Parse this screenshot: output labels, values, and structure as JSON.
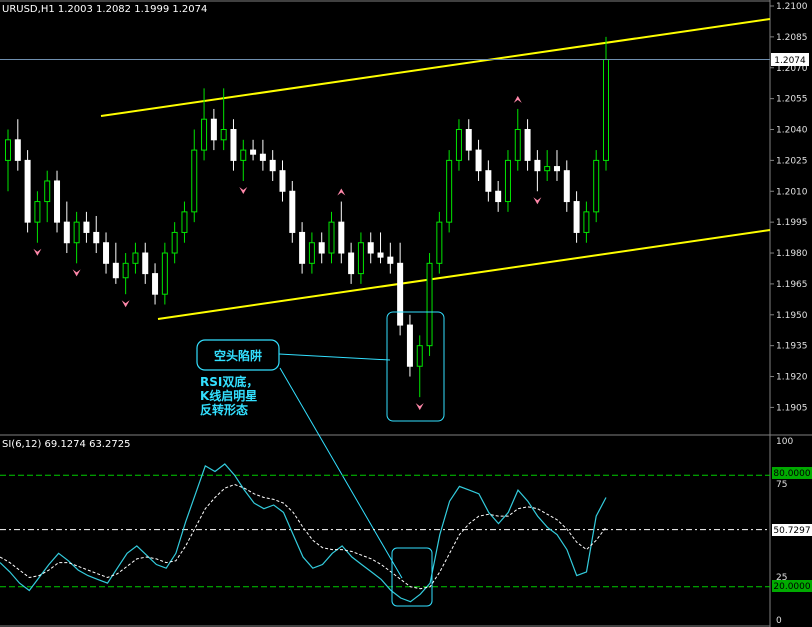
{
  "header": {
    "symbol_info": "URUSD,H1  1.2003 1.2082 1.1999 1.2074"
  },
  "rsi_header": "SI(6,12)  69.1274  63.2725",
  "price_axis": {
    "ticks": [
      "1.2100",
      "1.2085",
      "1.2070",
      "1.2055",
      "1.2040",
      "1.2025",
      "1.2010",
      "1.1995",
      "1.1980",
      "1.1965",
      "1.1950",
      "1.1935",
      "1.1920",
      "1.1905"
    ],
    "current": "1.2074"
  },
  "rsi_axis": {
    "ticks": [
      "100",
      "75",
      "25",
      "0"
    ],
    "level_high": "80.0000",
    "level_mid": "50.7297",
    "level_low": "20.0000"
  },
  "annotations": {
    "box_label": "空头陷阱",
    "note_line1": "RSI双底，",
    "note_line2": "K线启明星",
    "note_line3": "反转形态"
  },
  "colors": {
    "bull": "#00e600",
    "bear": "#ffffff",
    "channel": "#ffff00",
    "rsi_fast": "#33ccdd",
    "rsi_slow": "#ffffff",
    "level": "#00cc00",
    "annotation": "#33e0ff",
    "fractal": "#ff88aa"
  },
  "chart_data": {
    "type": "candlestick",
    "price_range": [
      1.1895,
      1.21
    ],
    "candles": [
      [
        1.2025,
        1.204,
        1.201,
        1.2035
      ],
      [
        1.2035,
        1.2045,
        1.202,
        1.2025
      ],
      [
        1.2025,
        1.203,
        1.199,
        1.1995
      ],
      [
        1.1995,
        1.201,
        1.1985,
        1.2005
      ],
      [
        1.2005,
        1.202,
        1.1995,
        1.2015
      ],
      [
        1.2015,
        1.202,
        1.199,
        1.1995
      ],
      [
        1.1995,
        1.2005,
        1.198,
        1.1985
      ],
      [
        1.1985,
        1.2,
        1.1975,
        1.1995
      ],
      [
        1.1995,
        1.2,
        1.1985,
        1.199
      ],
      [
        1.199,
        1.1998,
        1.198,
        1.1985
      ],
      [
        1.1985,
        1.199,
        1.197,
        1.1975
      ],
      [
        1.1975,
        1.1985,
        1.1965,
        1.1968
      ],
      [
        1.1968,
        1.198,
        1.196,
        1.1975
      ],
      [
        1.1975,
        1.1985,
        1.197,
        1.198
      ],
      [
        1.198,
        1.1985,
        1.1965,
        1.197
      ],
      [
        1.197,
        1.1975,
        1.1955,
        1.196
      ],
      [
        1.196,
        1.1985,
        1.1955,
        1.198
      ],
      [
        1.198,
        1.1995,
        1.1975,
        1.199
      ],
      [
        1.199,
        1.2005,
        1.1985,
        1.2
      ],
      [
        1.2,
        1.204,
        1.1995,
        1.203
      ],
      [
        1.203,
        1.206,
        1.2025,
        1.2045
      ],
      [
        1.2045,
        1.205,
        1.203,
        1.2035
      ],
      [
        1.2035,
        1.206,
        1.203,
        1.204
      ],
      [
        1.204,
        1.2045,
        1.202,
        1.2025
      ],
      [
        1.2025,
        1.2035,
        1.2015,
        1.203
      ],
      [
        1.203,
        1.2035,
        1.2025,
        1.2028
      ],
      [
        1.2028,
        1.2035,
        1.202,
        1.2025
      ],
      [
        1.2025,
        1.203,
        1.2015,
        1.202
      ],
      [
        1.202,
        1.2025,
        1.2005,
        1.201
      ],
      [
        1.201,
        1.2015,
        1.1985,
        1.199
      ],
      [
        1.199,
        1.1995,
        1.197,
        1.1975
      ],
      [
        1.1975,
        1.199,
        1.197,
        1.1985
      ],
      [
        1.1985,
        1.199,
        1.1975,
        1.198
      ],
      [
        1.198,
        1.2,
        1.1975,
        1.1995
      ],
      [
        1.1995,
        1.2005,
        1.1975,
        1.198
      ],
      [
        1.198,
        1.1985,
        1.1965,
        1.197
      ],
      [
        1.197,
        1.199,
        1.1965,
        1.1985
      ],
      [
        1.1985,
        1.199,
        1.1975,
        1.198
      ],
      [
        1.198,
        1.199,
        1.1975,
        1.1978
      ],
      [
        1.1978,
        1.1985,
        1.197,
        1.1975
      ],
      [
        1.1975,
        1.1985,
        1.194,
        1.1945
      ],
      [
        1.1945,
        1.195,
        1.192,
        1.1925
      ],
      [
        1.1925,
        1.194,
        1.191,
        1.1935
      ],
      [
        1.1935,
        1.198,
        1.193,
        1.1975
      ],
      [
        1.1975,
        1.2,
        1.197,
        1.1995
      ],
      [
        1.1995,
        1.203,
        1.199,
        1.2025
      ],
      [
        1.2025,
        1.2045,
        1.202,
        1.204
      ],
      [
        1.204,
        1.2045,
        1.2025,
        1.203
      ],
      [
        1.203,
        1.2035,
        1.2015,
        1.202
      ],
      [
        1.202,
        1.2025,
        1.2005,
        1.201
      ],
      [
        1.201,
        1.2015,
        1.2,
        1.2005
      ],
      [
        1.2005,
        1.203,
        1.2,
        1.2025
      ],
      [
        1.2025,
        1.205,
        1.202,
        1.204
      ],
      [
        1.204,
        1.2045,
        1.202,
        1.2025
      ],
      [
        1.2025,
        1.203,
        1.201,
        1.202
      ],
      [
        1.202,
        1.203,
        1.2015,
        1.2022
      ],
      [
        1.2022,
        1.203,
        1.2015,
        1.202
      ],
      [
        1.202,
        1.2025,
        1.2,
        1.2005
      ],
      [
        1.2005,
        1.201,
        1.1985,
        1.199
      ],
      [
        1.199,
        1.2005,
        1.1985,
        1.2
      ],
      [
        1.2,
        1.203,
        1.1995,
        1.2025
      ],
      [
        1.2025,
        1.2085,
        1.202,
        1.2074
      ]
    ],
    "rsi_range": [
      0,
      100
    ],
    "rsi_levels": [
      80,
      50.7297,
      20
    ],
    "rsi_fast": [
      33,
      28,
      22,
      18,
      25,
      32,
      38,
      34,
      29,
      26,
      24,
      22,
      30,
      38,
      42,
      37,
      32,
      30,
      38,
      55,
      70,
      85,
      82,
      86,
      80,
      72,
      65,
      62,
      64,
      60,
      48,
      36,
      30,
      32,
      38,
      42,
      36,
      32,
      28,
      24,
      18,
      14,
      12,
      16,
      22,
      48,
      66,
      74,
      72,
      70,
      60,
      54,
      60,
      72,
      66,
      58,
      52,
      48,
      40,
      26,
      28,
      58,
      68
    ],
    "rsi_slow": [
      36,
      33,
      29,
      25,
      26,
      29,
      33,
      33,
      31,
      29,
      27,
      25,
      27,
      31,
      35,
      36,
      35,
      33,
      34,
      42,
      52,
      62,
      68,
      73,
      75,
      73,
      70,
      68,
      67,
      65,
      60,
      52,
      45,
      41,
      40,
      40,
      39,
      37,
      35,
      32,
      28,
      24,
      20,
      19,
      20,
      28,
      38,
      48,
      54,
      58,
      59,
      58,
      58,
      62,
      63,
      62,
      59,
      56,
      51,
      44,
      40,
      45,
      52
    ]
  }
}
